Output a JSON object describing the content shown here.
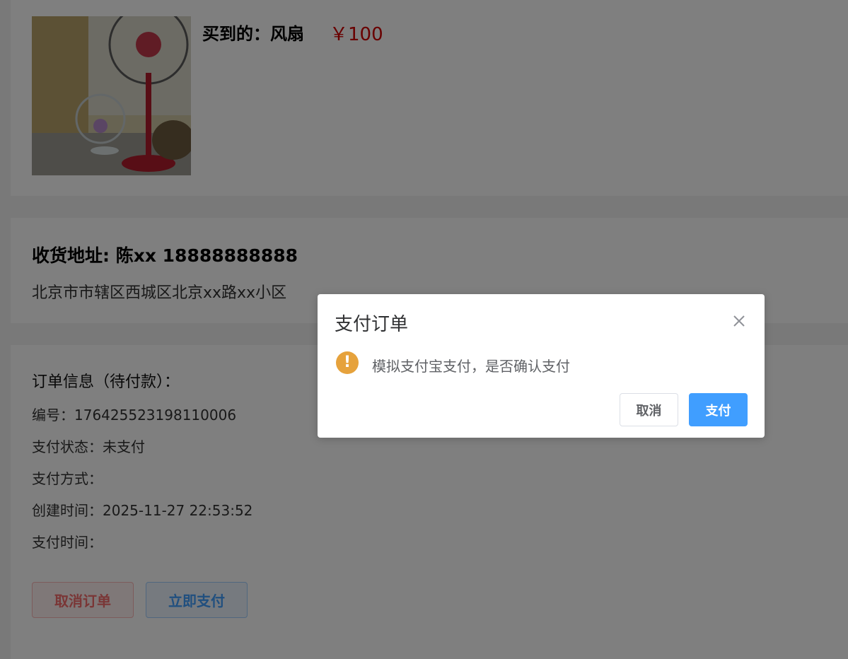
{
  "product": {
    "title": "买到的：风扇",
    "price": "￥100",
    "image_icon": "fan-photo"
  },
  "address": {
    "title": "收货地址: 陈xx 18888888888",
    "detail": "北京市市辖区西城区北京xx路xx小区"
  },
  "order": {
    "title": "订单信息（待付款）：",
    "number": "编号：176425523198110006",
    "pay_status": "支付状态：未支付",
    "pay_method": "支付方式：",
    "created_time": "创建时间：2025-11-27 22:53:52",
    "pay_time": "支付时间：",
    "cancel_label": "取消订单",
    "pay_label": "立即支付"
  },
  "dialog": {
    "title": "支付订单",
    "message": "模拟支付宝支付，是否确认支付",
    "cancel_label": "取消",
    "confirm_label": "支付",
    "icon": "warning-icon",
    "warn_glyph": "!"
  },
  "colors": {
    "price": "#d30000",
    "primary": "#409eff",
    "danger": "#f56c6c",
    "warning": "#e6a23c",
    "overlay": "rgba(0,0,0,0.5)"
  }
}
